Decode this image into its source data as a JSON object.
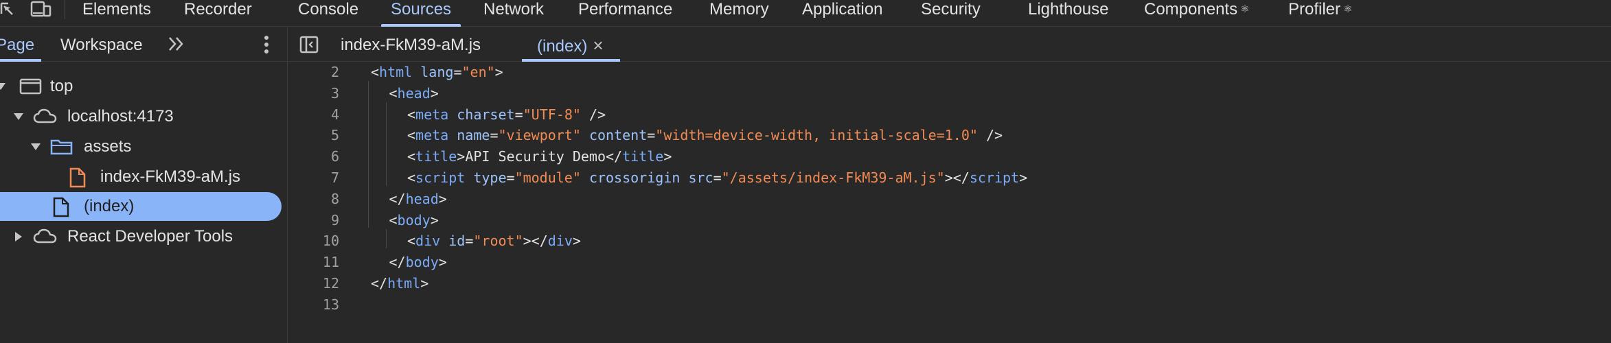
{
  "panel_tabs": [
    {
      "label": "Elements",
      "active": false
    },
    {
      "label": "Recorder",
      "active": false
    },
    {
      "label": "Console",
      "active": false
    },
    {
      "label": "Sources",
      "active": true
    },
    {
      "label": "Network",
      "active": false
    },
    {
      "label": "Performance",
      "active": false
    },
    {
      "label": "Memory",
      "active": false
    },
    {
      "label": "Application",
      "active": false
    },
    {
      "label": "Security",
      "active": false
    },
    {
      "label": "Lighthouse",
      "active": false
    },
    {
      "label": "Components",
      "active": false,
      "icon": "gear-icon"
    },
    {
      "label": "Profiler",
      "active": false,
      "icon": "gear-icon"
    }
  ],
  "toolbar_icons": [
    "select-element-icon",
    "device-toolbar-icon"
  ],
  "navigator": {
    "tabs": [
      {
        "label": "Page",
        "active": true
      },
      {
        "label": "Workspace",
        "active": false
      }
    ],
    "more_icon": "chevrons-right-icon",
    "menu_icon": "kebab-menu-icon",
    "tree": [
      {
        "label": "top",
        "icon": "frame-icon",
        "expanded": true,
        "selected": false
      },
      {
        "label": "localhost:4173",
        "icon": "cloud-icon",
        "expanded": true,
        "selected": false
      },
      {
        "label": "assets",
        "icon": "folder-icon",
        "expanded": true,
        "selected": false
      },
      {
        "label": "index-FkM39-aM.js",
        "icon": "js-file-icon",
        "selected": false
      },
      {
        "label": "(index)",
        "icon": "file-icon",
        "selected": true
      },
      {
        "label": "React Developer Tools",
        "icon": "cloud-icon",
        "expanded": false,
        "selected": false
      }
    ]
  },
  "editor": {
    "toggle_icon": "sidebar-toggle-icon",
    "tabs": [
      {
        "label": "index-FkM39-aM.js",
        "active": false
      },
      {
        "label": "(index)",
        "active": true,
        "close_glyph": "×"
      }
    ],
    "lines": [
      {
        "no": "2",
        "tokens": [
          [
            "punc",
            "<"
          ],
          [
            "tag",
            "html"
          ],
          [
            "punc",
            " "
          ],
          [
            "attr",
            "lang"
          ],
          [
            "punc",
            "="
          ],
          [
            "val",
            "\"en\""
          ],
          [
            "punc",
            ">"
          ]
        ]
      },
      {
        "no": "3",
        "tokens": [
          [
            "punc",
            "<"
          ],
          [
            "tag",
            "head"
          ],
          [
            "punc",
            ">"
          ]
        ]
      },
      {
        "no": "4",
        "tokens": [
          [
            "punc",
            "<"
          ],
          [
            "tag",
            "meta"
          ],
          [
            "punc",
            " "
          ],
          [
            "attr",
            "charset"
          ],
          [
            "punc",
            "="
          ],
          [
            "val",
            "\"UTF-8\""
          ],
          [
            "punc",
            " />"
          ]
        ]
      },
      {
        "no": "5",
        "tokens": [
          [
            "punc",
            "<"
          ],
          [
            "tag",
            "meta"
          ],
          [
            "punc",
            " "
          ],
          [
            "attr",
            "name"
          ],
          [
            "punc",
            "="
          ],
          [
            "val",
            "\"viewport\""
          ],
          [
            "punc",
            " "
          ],
          [
            "attr",
            "content"
          ],
          [
            "punc",
            "="
          ],
          [
            "val",
            "\"width=device-width, initial-scale=1.0\""
          ],
          [
            "punc",
            " />"
          ]
        ]
      },
      {
        "no": "6",
        "tokens": [
          [
            "punc",
            "<"
          ],
          [
            "tag",
            "title"
          ],
          [
            "punc",
            ">"
          ],
          [
            "text",
            "API Security Demo"
          ],
          [
            "punc",
            "</"
          ],
          [
            "tag",
            "title"
          ],
          [
            "punc",
            ">"
          ]
        ]
      },
      {
        "no": "7",
        "tokens": [
          [
            "punc",
            "<"
          ],
          [
            "tag",
            "script"
          ],
          [
            "punc",
            " "
          ],
          [
            "attr",
            "type"
          ],
          [
            "punc",
            "="
          ],
          [
            "val",
            "\"module\""
          ],
          [
            "punc",
            " "
          ],
          [
            "attr",
            "crossorigin"
          ],
          [
            "punc",
            " "
          ],
          [
            "attr",
            "src"
          ],
          [
            "punc",
            "="
          ],
          [
            "val",
            "\"/assets/index-FkM39-aM.js\""
          ],
          [
            "punc",
            "></"
          ],
          [
            "tag",
            "script"
          ],
          [
            "punc",
            ">"
          ]
        ]
      },
      {
        "no": "8",
        "tokens": [
          [
            "punc",
            "</"
          ],
          [
            "tag",
            "head"
          ],
          [
            "punc",
            ">"
          ]
        ]
      },
      {
        "no": "9",
        "tokens": [
          [
            "punc",
            "<"
          ],
          [
            "tag",
            "body"
          ],
          [
            "punc",
            ">"
          ]
        ]
      },
      {
        "no": "10",
        "tokens": [
          [
            "punc",
            "<"
          ],
          [
            "tag",
            "div"
          ],
          [
            "punc",
            " "
          ],
          [
            "attr",
            "id"
          ],
          [
            "punc",
            "="
          ],
          [
            "val",
            "\"root\""
          ],
          [
            "punc",
            "></"
          ],
          [
            "tag",
            "div"
          ],
          [
            "punc",
            ">"
          ]
        ]
      },
      {
        "no": "11",
        "tokens": [
          [
            "punc",
            "</"
          ],
          [
            "tag",
            "body"
          ],
          [
            "punc",
            ">"
          ]
        ]
      },
      {
        "no": "12",
        "tokens": [
          [
            "punc",
            "</"
          ],
          [
            "tag",
            "html"
          ],
          [
            "punc",
            ">"
          ]
        ]
      },
      {
        "no": "13",
        "tokens": []
      }
    ]
  },
  "colors": {
    "background": "#282828",
    "accent": "#a8c7fa",
    "selection": "#8ab4f8",
    "tag": "#7cacf8",
    "attribute": "#9dc3fb",
    "value": "#f28b54",
    "js_file_icon": "#f28b54",
    "folder_icon": "#8ab4f8"
  }
}
